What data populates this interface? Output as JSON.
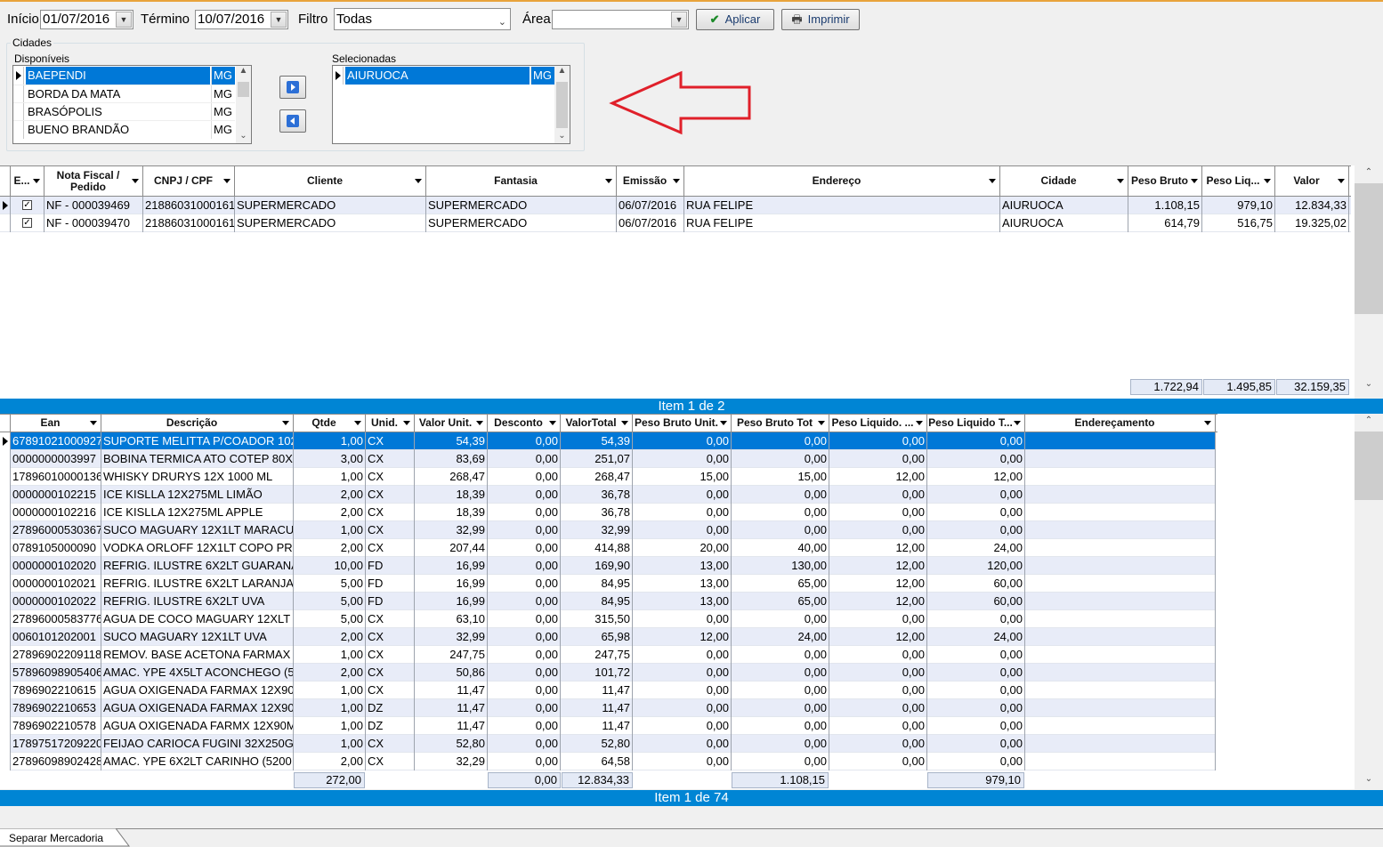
{
  "filters": {
    "inicio_label": "Início",
    "inicio_value": "01/07/2016",
    "termino_label": "Término",
    "termino_value": "10/07/2016",
    "filtro_label": "Filtro",
    "filtro_value": "Todas",
    "area_label": "Área",
    "area_value": "",
    "aplicar_label": "Aplicar",
    "imprimir_label": "Imprimir"
  },
  "cidades": {
    "group_label": "Cidades",
    "disponiveis_label": "Disponíveis",
    "selecionadas_label": "Selecionadas",
    "disponiveis": [
      {
        "name": "BAEPENDI",
        "uf": "MG"
      },
      {
        "name": "BORDA DA MATA",
        "uf": "MG"
      },
      {
        "name": "BRASÓPOLIS",
        "uf": "MG"
      },
      {
        "name": "BUENO BRANDÃO",
        "uf": "MG"
      }
    ],
    "selecionadas": [
      {
        "name": "AIURUOCA",
        "uf": "MG"
      }
    ]
  },
  "notes_grid": {
    "headers": [
      "E...",
      "Nota Fiscal / Pedido",
      "CNPJ / CPF",
      "Cliente",
      "Fantasia",
      "Emissão",
      "Endereço",
      "Cidade",
      "Peso Bruto",
      "Peso Liq...",
      "Valor"
    ],
    "rows": [
      {
        "nota": "NF - 000039469",
        "cnpj": "21886031000161",
        "cliente": "SUPERMERCADO",
        "fantasia": "SUPERMERCADO",
        "emissao": "06/07/2016",
        "endereco": "RUA FELIPE",
        "cidade": "AIURUOCA",
        "peso_bruto": "1.108,15",
        "peso_liq": "979,10",
        "valor": "12.834,33"
      },
      {
        "nota": "NF - 000039470",
        "cnpj": "21886031000161",
        "cliente": "SUPERMERCADO",
        "fantasia": "SUPERMERCADO",
        "emissao": "06/07/2016",
        "endereco": "RUA FELIPE",
        "cidade": "AIURUOCA",
        "peso_bruto": "614,79",
        "peso_liq": "516,75",
        "valor": "19.325,02"
      }
    ],
    "totals": {
      "peso_bruto": "1.722,94",
      "peso_liq": "1.495,85",
      "valor": "32.159,35"
    },
    "status": "Item 1 de 2"
  },
  "items_grid": {
    "headers": [
      "Ean",
      "Descrição",
      "Qtde",
      "Unid.",
      "Valor Unit.",
      "Desconto",
      "ValorTotal",
      "Peso Bruto Unit.",
      "Peso Bruto Tot",
      "Peso Liquido. ...",
      "Peso Liquido T...",
      "Endereçamento"
    ],
    "rows": [
      [
        "67891021000927",
        "SUPORTE MELITTA P/COADOR 102",
        "1,00",
        "CX",
        "54,39",
        "0,00",
        "54,39",
        "0,00",
        "0,00",
        "0,00",
        "0,00",
        ""
      ],
      [
        "0000000003997",
        "BOBINA TERMICA ATO COTEP 80X4",
        "3,00",
        "CX",
        "83,69",
        "0,00",
        "251,07",
        "0,00",
        "0,00",
        "0,00",
        "0,00",
        ""
      ],
      [
        "17896010000136",
        "WHISKY DRURYS 12X 1000 ML",
        "1,00",
        "CX",
        "268,47",
        "0,00",
        "268,47",
        "15,00",
        "15,00",
        "12,00",
        "12,00",
        ""
      ],
      [
        "0000000102215",
        "ICE KISLLA 12X275ML LIMÃO",
        "2,00",
        "CX",
        "18,39",
        "0,00",
        "36,78",
        "0,00",
        "0,00",
        "0,00",
        "0,00",
        ""
      ],
      [
        "0000000102216",
        "ICE KISLLA 12X275ML  APPLE",
        "2,00",
        "CX",
        "18,39",
        "0,00",
        "36,78",
        "0,00",
        "0,00",
        "0,00",
        "0,00",
        ""
      ],
      [
        "27896000530367",
        "SUCO MAGUARY 12X1LT MARACU",
        "1,00",
        "CX",
        "32,99",
        "0,00",
        "32,99",
        "0,00",
        "0,00",
        "0,00",
        "0,00",
        ""
      ],
      [
        "0789105000090",
        "VODKA ORLOFF 12X1LT COPO PR",
        "2,00",
        "CX",
        "207,44",
        "0,00",
        "414,88",
        "20,00",
        "40,00",
        "12,00",
        "24,00",
        ""
      ],
      [
        "0000000102020",
        "REFRIG. ILUSTRE 6X2LT GUARANÁ",
        "10,00",
        "FD",
        "16,99",
        "0,00",
        "169,90",
        "13,00",
        "130,00",
        "12,00",
        "120,00",
        ""
      ],
      [
        "0000000102021",
        "REFRIG. ILUSTRE 6X2LT LARANJA",
        "5,00",
        "FD",
        "16,99",
        "0,00",
        "84,95",
        "13,00",
        "65,00",
        "12,00",
        "60,00",
        ""
      ],
      [
        "0000000102022",
        "REFRIG. ILUSTRE 6X2LT UVA",
        "5,00",
        "FD",
        "16,99",
        "0,00",
        "84,95",
        "13,00",
        "65,00",
        "12,00",
        "60,00",
        ""
      ],
      [
        "27896000583776",
        "AGUA DE COCO MAGUARY 12XLT",
        "5,00",
        "CX",
        "63,10",
        "0,00",
        "315,50",
        "0,00",
        "0,00",
        "0,00",
        "0,00",
        ""
      ],
      [
        "0060101202001",
        "SUCO MAGUARY 12X1LT UVA",
        "2,00",
        "CX",
        "32,99",
        "0,00",
        "65,98",
        "12,00",
        "24,00",
        "12,00",
        "24,00",
        ""
      ],
      [
        "27896902209118",
        "REMOV. BASE ACETONA FARMAX",
        "1,00",
        "CX",
        "247,75",
        "0,00",
        "247,75",
        "0,00",
        "0,00",
        "0,00",
        "0,00",
        ""
      ],
      [
        "57896098905406",
        "AMAC. YPE 4X5LT ACONCHEGO (5",
        "2,00",
        "CX",
        "50,86",
        "0,00",
        "101,72",
        "0,00",
        "0,00",
        "0,00",
        "0,00",
        ""
      ],
      [
        "7896902210615",
        "AGUA OXIGENADA FARMAX 12X90M",
        "1,00",
        "CX",
        "11,47",
        "0,00",
        "11,47",
        "0,00",
        "0,00",
        "0,00",
        "0,00",
        ""
      ],
      [
        "7896902210653",
        "AGUA OXIGENADA FARMAX 12X90M",
        "1,00",
        "DZ",
        "11,47",
        "0,00",
        "11,47",
        "0,00",
        "0,00",
        "0,00",
        "0,00",
        ""
      ],
      [
        "7896902210578",
        "AGUA OXIGENADA FARMX 12X90M",
        "1,00",
        "DZ",
        "11,47",
        "0,00",
        "11,47",
        "0,00",
        "0,00",
        "0,00",
        "0,00",
        ""
      ],
      [
        "17897517209220",
        "FEIJAO CARIOCA FUGINI 32X250G",
        "1,00",
        "CX",
        "52,80",
        "0,00",
        "52,80",
        "0,00",
        "0,00",
        "0,00",
        "0,00",
        ""
      ],
      [
        "27896098902428",
        "AMAC. YPE 6X2LT CARINHO (5200",
        "2,00",
        "CX",
        "32,29",
        "0,00",
        "64,58",
        "0,00",
        "0,00",
        "0,00",
        "0,00",
        ""
      ]
    ],
    "totals": {
      "qtde": "272,00",
      "desconto": "0,00",
      "valor_total": "12.834,33",
      "peso_bruto_tot": "1.108,15",
      "peso_liq_tot": "979,10"
    },
    "status": "Item 1 de 74"
  },
  "tab_label": "Separar Mercadoria",
  "colors": {
    "accent": "#0078d7",
    "status_bar": "#0085d4",
    "arrow": "#e0202a",
    "top_line": "#e8a33c"
  }
}
